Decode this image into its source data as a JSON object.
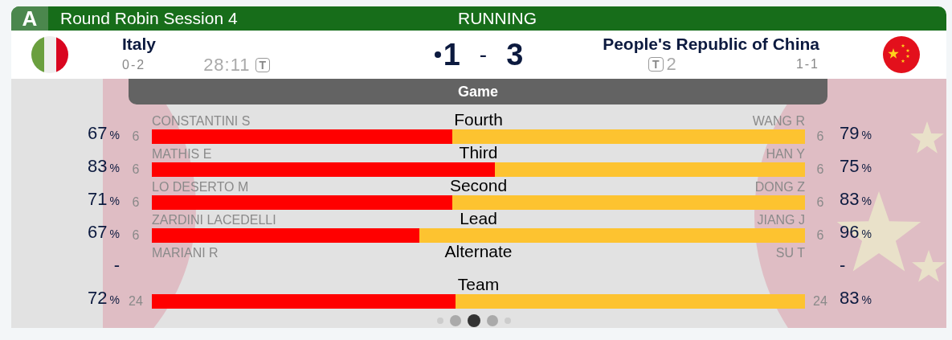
{
  "event": {
    "badge": "A",
    "title": "Round Robin Session 4",
    "status": "RUNNING"
  },
  "teams": [
    {
      "name": "Italy",
      "record": "0-2",
      "clock": "28:11",
      "timeout_label": "T",
      "score": "1",
      "hammer": true
    },
    {
      "name": "People's Republic of China",
      "record": "1-1",
      "clock": "2",
      "timeout_label": "T",
      "score": "3",
      "hammer": false
    }
  ],
  "score_separator": "-",
  "tab": {
    "label": "Game"
  },
  "positions": [
    {
      "kind": "bar",
      "position": "Fourth",
      "level": 0.46,
      "left": {
        "player": "CONSTANTINI S",
        "count": "6",
        "pct": "67",
        "unit": "%"
      },
      "right": {
        "player": "WANG R",
        "count": "6",
        "pct": "79",
        "unit": "%"
      }
    },
    {
      "kind": "bar",
      "position": "Third",
      "level": 0.525,
      "left": {
        "player": "MATHIS E",
        "count": "6",
        "pct": "83",
        "unit": "%"
      },
      "right": {
        "player": "HAN Y",
        "count": "6",
        "pct": "75",
        "unit": "%"
      }
    },
    {
      "kind": "bar",
      "position": "Second",
      "level": 0.46,
      "left": {
        "player": "LO DESERTO M",
        "count": "6",
        "pct": "71",
        "unit": "%"
      },
      "right": {
        "player": "DONG Z",
        "count": "6",
        "pct": "83",
        "unit": "%"
      }
    },
    {
      "kind": "bar",
      "position": "Lead",
      "level": 0.41,
      "left": {
        "player": "ZARDINI LACEDELLI",
        "count": "6",
        "pct": "67",
        "unit": "%"
      },
      "right": {
        "player": "JIANG J",
        "count": "6",
        "pct": "96",
        "unit": "%"
      }
    },
    {
      "kind": "empty",
      "position": "Alternate",
      "left": {
        "player": "MARIANI R",
        "pct": "-"
      },
      "right": {
        "player": "SU T",
        "pct": "-"
      }
    },
    {
      "kind": "bar",
      "position": "Team",
      "level": 0.465,
      "left": {
        "count": "24",
        "pct": "72",
        "unit": "%"
      },
      "right": {
        "count": "24",
        "pct": "83",
        "unit": "%"
      }
    }
  ],
  "pager": [
    {
      "selected": false
    },
    {
      "selected": false
    },
    {
      "selected": true
    },
    {
      "selected": false
    },
    {
      "selected": false
    }
  ]
}
